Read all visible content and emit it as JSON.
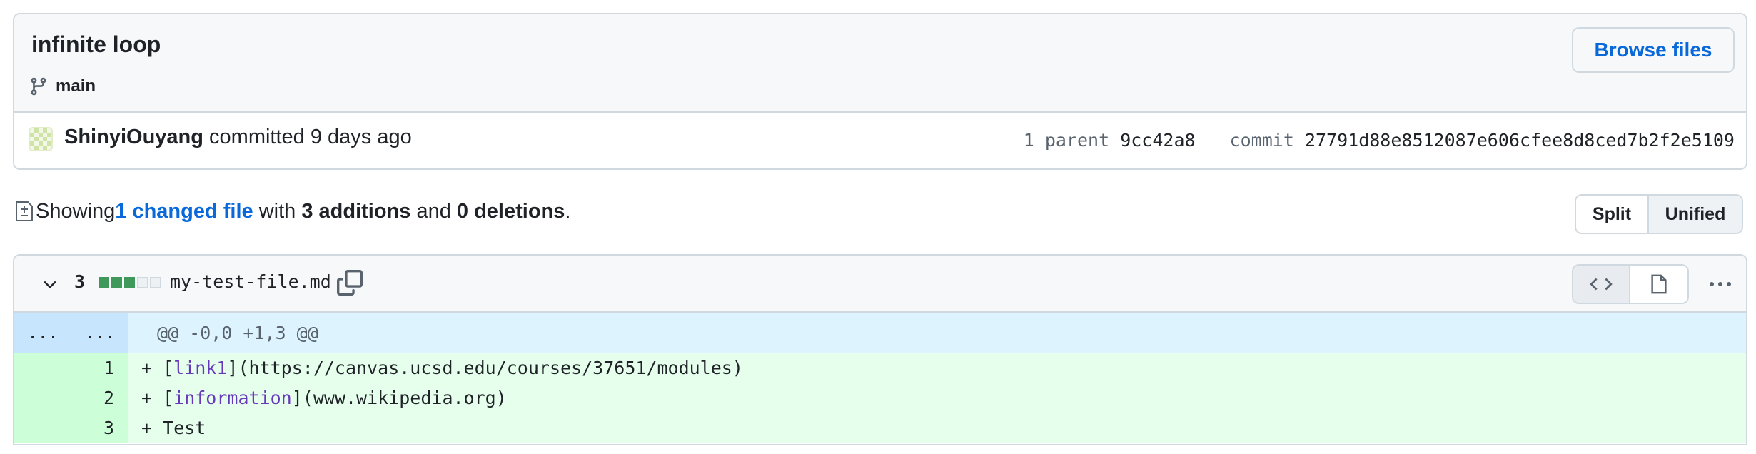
{
  "commit": {
    "title": "infinite loop",
    "branch": "main",
    "browse_label": "Browse files",
    "author": "ShinyiOuyang",
    "action": " committed 9 days ago",
    "parent_label": "1 parent",
    "parent_sha": "9cc42a8",
    "commit_label": "commit",
    "commit_sha": "27791d88e8512087e606cfee8d8ced7b2f2e5109"
  },
  "summary": {
    "showing": "Showing ",
    "changed_files": "1 changed file",
    "with": " with ",
    "additions": "3 additions",
    "and": " and ",
    "deletions": "0 deletions",
    "period": "."
  },
  "view_toggle": {
    "split": "Split",
    "unified": "Unified",
    "selected": "Unified"
  },
  "file": {
    "changes": "3",
    "name": "my-test-file.md",
    "diffstat": [
      "add",
      "add",
      "add",
      "neutral",
      "neutral"
    ],
    "hunk": {
      "left_gutter": "...",
      "right_gutter": "...",
      "header": "@@ -0,0 +1,3 @@"
    },
    "lines": [
      {
        "num": "1",
        "prefix": "+ [",
        "link": "link1",
        "suffix": "](https://canvas.ucsd.edu/courses/37651/modules)"
      },
      {
        "num": "2",
        "prefix": "+ [",
        "link": "information",
        "suffix": "](www.wikipedia.org)"
      },
      {
        "num": "3",
        "prefix": "+ Test",
        "link": "",
        "suffix": ""
      }
    ]
  },
  "colors": {
    "accent": "#0969da",
    "addition_bg": "#e6ffec",
    "addition_gutter": "#ccffd8",
    "hunk_bg": "#ddf4ff",
    "link_token": "#6639ba"
  }
}
